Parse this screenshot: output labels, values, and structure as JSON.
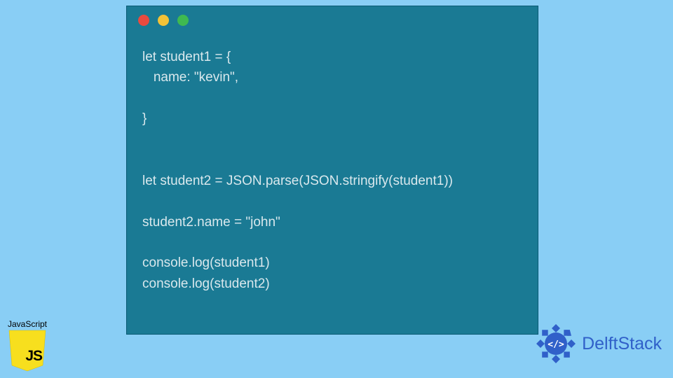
{
  "code": {
    "lines": [
      "let student1 = {",
      "   name: \"kevin\",",
      "",
      "}",
      "",
      "",
      "let student2 = JSON.parse(JSON.stringify(student1))",
      "",
      "student2.name = \"john\"",
      "",
      "console.log(student1)",
      "console.log(student2)"
    ]
  },
  "badges": {
    "js_label": "JavaScript",
    "js_text": "JS",
    "delft_text": "DelftStack"
  },
  "colors": {
    "background": "#89cef5",
    "window": "#1a7a94",
    "code_text": "#d9e8ed",
    "js_yellow": "#f7df1e",
    "delft_blue": "#3060c9"
  }
}
